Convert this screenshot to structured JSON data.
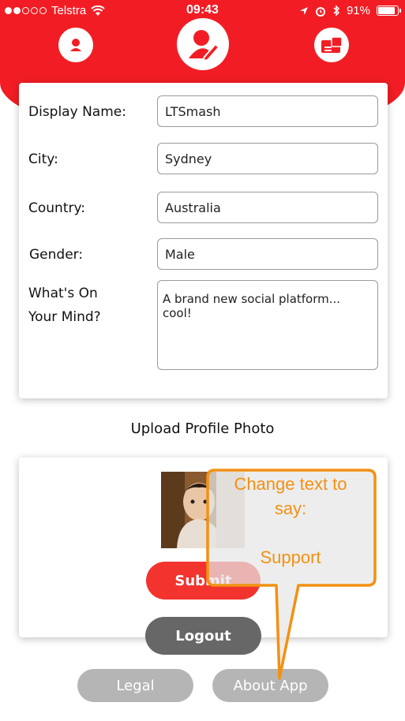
{
  "status_bar": {
    "carrier": "Telstra",
    "time": "09:43",
    "battery": "91%",
    "battery_level": 0.91
  },
  "nav": {
    "icons": [
      "profile-icon",
      "edit-profile-icon",
      "wallet-icon"
    ]
  },
  "form": {
    "display_name_label": "Display Name:",
    "display_name_value": "LTSmash",
    "city_label": "City:",
    "city_value": "Sydney",
    "country_label": "Country:",
    "country_value": "Australia",
    "gender_label": "Gender:",
    "gender_value": "Male",
    "mind_label_1": "What's On",
    "mind_label_2": "Your Mind?",
    "mind_value": "A brand new social platform... cool!"
  },
  "upload": {
    "title": "Upload Profile Photo"
  },
  "buttons": {
    "submit": "Submit",
    "logout": "Logout",
    "legal": "Legal",
    "about": "About App"
  },
  "annotation": {
    "line1": "Change text to",
    "line2": "say:",
    "line3": "Support"
  },
  "colors": {
    "brand_red": "#f21d24",
    "callout_orange": "#f29112",
    "logout_gray": "#676767",
    "footer_gray": "#b5b5b5"
  }
}
